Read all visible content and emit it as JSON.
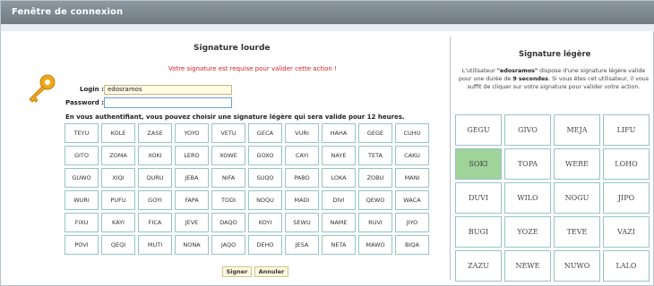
{
  "window": {
    "title": "Fenêtre de connexion"
  },
  "heavy": {
    "title": "Signature lourde",
    "warning": "Votre signature est requise pour valider cette action !",
    "login_label": "Login :",
    "login_value": "edosramos",
    "password_label": "Password :",
    "password_value": "",
    "info": "En vous authentifiant, vous pouvez choisir une signature légère qui sera valide pour 12 heures.",
    "codes": [
      [
        "TEYU",
        "KOLE",
        "ZASE",
        "YOYO",
        "VETU",
        "GECA",
        "VURI",
        "HAHA",
        "GEGE",
        "CUHU"
      ],
      [
        "GITO",
        "ZOMA",
        "XOKI",
        "LERO",
        "XOWE",
        "GOXO",
        "CAYI",
        "NAYE",
        "TETA",
        "CAKU"
      ],
      [
        "GUWO",
        "XIQI",
        "QURU",
        "JEBA",
        "NIFA",
        "SUQO",
        "PABO",
        "LOKA",
        "ZOBU",
        "MANI"
      ],
      [
        "WURI",
        "PUFU",
        "GOYI",
        "FAPA",
        "TODI",
        "NOQU",
        "MADI",
        "DIVI",
        "QEWO",
        "WACA"
      ],
      [
        "FIXU",
        "KAYI",
        "FICA",
        "JEVE",
        "DAQO",
        "KOYI",
        "SEWU",
        "NAME",
        "RUVI",
        "JIYO"
      ],
      [
        "POVI",
        "QEQI",
        "MUTI",
        "NONA",
        "JAQO",
        "DEHO",
        "JESA",
        "NETA",
        "MAWO",
        "BIQA"
      ]
    ],
    "sign_button": "Signer",
    "cancel_button": "Annuler"
  },
  "light": {
    "title": "Signature légère",
    "desc_prefix": "L'utilisateur ",
    "desc_user": "\"edosramos\"",
    "desc_mid": " dispose d'une signature légère valide pour une durée de ",
    "desc_duration": "9 secondes",
    "desc_suffix": ". Si vous êtes cet utilisateur, il vous suffit de cliquer sur votre signature pour valider votre action.",
    "codes": [
      [
        "GEGU",
        "GIVO",
        "MEJA",
        "LIFU"
      ],
      [
        "SOKI",
        "TOPA",
        "WERE",
        "LOHO"
      ],
      [
        "DUVI",
        "WILO",
        "NOGU",
        "JIPO"
      ],
      [
        "BUGI",
        "YOZE",
        "TEVE",
        "VAZI"
      ],
      [
        "ZAZU",
        "NEWE",
        "NUWO",
        "LALO"
      ]
    ],
    "selected": "SOKI",
    "selected_color": "#9fd39a"
  }
}
